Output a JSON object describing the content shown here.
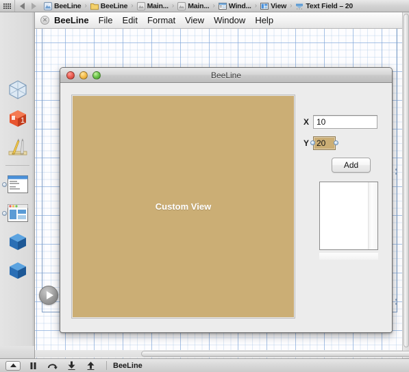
{
  "jumpbar": {
    "grid_icon": "grid-icon",
    "back_icon": "back-arrow-icon",
    "forward_icon": "forward-arrow-icon",
    "separator": "›",
    "crumbs": [
      {
        "label": "BeeLine",
        "icon": "project-icon"
      },
      {
        "label": "BeeLine",
        "icon": "folder-icon"
      },
      {
        "label": "Main...",
        "icon": "storyboard-icon"
      },
      {
        "label": "Main...",
        "icon": "storyboard-icon"
      },
      {
        "label": "Wind...",
        "icon": "window-icon"
      },
      {
        "label": "View",
        "icon": "view-icon"
      },
      {
        "label": "Text Field – 20",
        "icon": "textfield-icon"
      }
    ]
  },
  "library_strip": {
    "items": [
      {
        "name": "file-template-library",
        "icon": "wireframe-cube-icon"
      },
      {
        "name": "code-snippet-library",
        "icon": "red-cube-icon"
      },
      {
        "name": "object-library",
        "icon": "ruler-pencil-icon"
      },
      {
        "name": "menu-object",
        "icon": "menu-window-icon"
      },
      {
        "name": "window-object",
        "icon": "app-window-icon"
      },
      {
        "name": "blue-cube-object-1",
        "icon": "blue-cube-icon"
      },
      {
        "name": "blue-cube-object-2",
        "icon": "blue-cube-icon"
      }
    ]
  },
  "ib_menubar": {
    "close_glyph": "✕",
    "app_name": "BeeLine",
    "menus": [
      "File",
      "Edit",
      "Format",
      "View",
      "Window",
      "Help"
    ]
  },
  "canvas": {
    "document_close_glyph": "✕",
    "run_button": "run-play-button"
  },
  "app_window": {
    "title": "BeeLine",
    "traffic_lights": [
      "close-button",
      "minimize-button",
      "zoom-button"
    ],
    "custom_view": {
      "label": "Custom View",
      "fill_color": "#cbae75",
      "text_color": "#ffffff"
    },
    "controls": {
      "x_label": "X",
      "x_value": "10",
      "y_label": "Y",
      "y_value": "20",
      "y_selected": true,
      "add_button": "Add",
      "table_view": "table-view"
    }
  },
  "debug_bar": {
    "buttons": [
      {
        "name": "toggle-debug-area-button",
        "icon": "up-triangle-icon"
      },
      {
        "name": "pause-button",
        "icon": "pause-icon"
      },
      {
        "name": "step-over-button",
        "icon": "step-over-icon"
      },
      {
        "name": "step-into-button",
        "icon": "step-into-icon"
      },
      {
        "name": "step-out-button",
        "icon": "step-out-icon"
      }
    ],
    "process_label": "BeeLine"
  }
}
